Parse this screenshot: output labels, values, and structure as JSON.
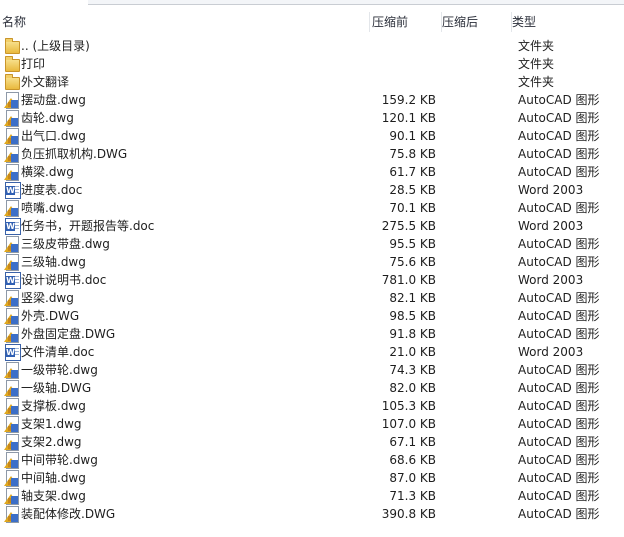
{
  "columns": {
    "name": "名称",
    "original_size": "压缩前",
    "compressed_size": "压缩后",
    "type": "类型"
  },
  "files": [
    {
      "name": ".. (上级目录)",
      "size": "",
      "type": "文件夹",
      "icon": "folder-icon"
    },
    {
      "name": "打印",
      "size": "",
      "type": "文件夹",
      "icon": "folder-icon"
    },
    {
      "name": "外文翻译",
      "size": "",
      "type": "文件夹",
      "icon": "folder-icon"
    },
    {
      "name": "摆动盘.dwg",
      "size": "159.2 KB",
      "type": "AutoCAD 图形",
      "icon": "dwg-file-icon"
    },
    {
      "name": "齿轮.dwg",
      "size": "120.1 KB",
      "type": "AutoCAD 图形",
      "icon": "dwg-file-icon"
    },
    {
      "name": "出气口.dwg",
      "size": "90.1 KB",
      "type": "AutoCAD 图形",
      "icon": "dwg-file-icon"
    },
    {
      "name": "负压抓取机构.DWG",
      "size": "75.8 KB",
      "type": "AutoCAD 图形",
      "icon": "dwg-file-icon"
    },
    {
      "name": "横梁.dwg",
      "size": "61.7 KB",
      "type": "AutoCAD 图形",
      "icon": "dwg-file-icon"
    },
    {
      "name": "进度表.doc",
      "size": "28.5 KB",
      "type": "Word 2003",
      "icon": "word-doc-icon"
    },
    {
      "name": "喷嘴.dwg",
      "size": "70.1 KB",
      "type": "AutoCAD 图形",
      "icon": "dwg-file-icon"
    },
    {
      "name": "任务书，开题报告等.doc",
      "size": "275.5 KB",
      "type": "Word 2003",
      "icon": "word-doc-icon"
    },
    {
      "name": "三级皮带盘.dwg",
      "size": "95.5 KB",
      "type": "AutoCAD 图形",
      "icon": "dwg-file-icon"
    },
    {
      "name": "三级轴.dwg",
      "size": "75.6 KB",
      "type": "AutoCAD 图形",
      "icon": "dwg-file-icon"
    },
    {
      "name": "设计说明书.doc",
      "size": "781.0 KB",
      "type": "Word 2003",
      "icon": "word-doc-icon"
    },
    {
      "name": "竖梁.dwg",
      "size": "82.1 KB",
      "type": "AutoCAD 图形",
      "icon": "dwg-file-icon"
    },
    {
      "name": "外壳.DWG",
      "size": "98.5 KB",
      "type": "AutoCAD 图形",
      "icon": "dwg-file-icon"
    },
    {
      "name": "外盘固定盘.DWG",
      "size": "91.8 KB",
      "type": "AutoCAD 图形",
      "icon": "dwg-file-icon"
    },
    {
      "name": "文件清单.doc",
      "size": "21.0 KB",
      "type": "Word 2003",
      "icon": "word-doc-icon"
    },
    {
      "name": "一级带轮.dwg",
      "size": "74.3 KB",
      "type": "AutoCAD 图形",
      "icon": "dwg-file-icon"
    },
    {
      "name": "一级轴.DWG",
      "size": "82.0 KB",
      "type": "AutoCAD 图形",
      "icon": "dwg-file-icon"
    },
    {
      "name": "支撑板.dwg",
      "size": "105.3 KB",
      "type": "AutoCAD 图形",
      "icon": "dwg-file-icon"
    },
    {
      "name": "支架1.dwg",
      "size": "107.0 KB",
      "type": "AutoCAD 图形",
      "icon": "dwg-file-icon"
    },
    {
      "name": "支架2.dwg",
      "size": "67.1 KB",
      "type": "AutoCAD 图形",
      "icon": "dwg-file-icon"
    },
    {
      "name": "中间带轮.dwg",
      "size": "68.6 KB",
      "type": "AutoCAD 图形",
      "icon": "dwg-file-icon"
    },
    {
      "name": "中间轴.dwg",
      "size": "87.0 KB",
      "type": "AutoCAD 图形",
      "icon": "dwg-file-icon"
    },
    {
      "name": "轴支架.dwg",
      "size": "71.3 KB",
      "type": "AutoCAD 图形",
      "icon": "dwg-file-icon"
    },
    {
      "name": "装配体修改.DWG",
      "size": "390.8 KB",
      "type": "AutoCAD 图形",
      "icon": "dwg-file-icon"
    }
  ]
}
